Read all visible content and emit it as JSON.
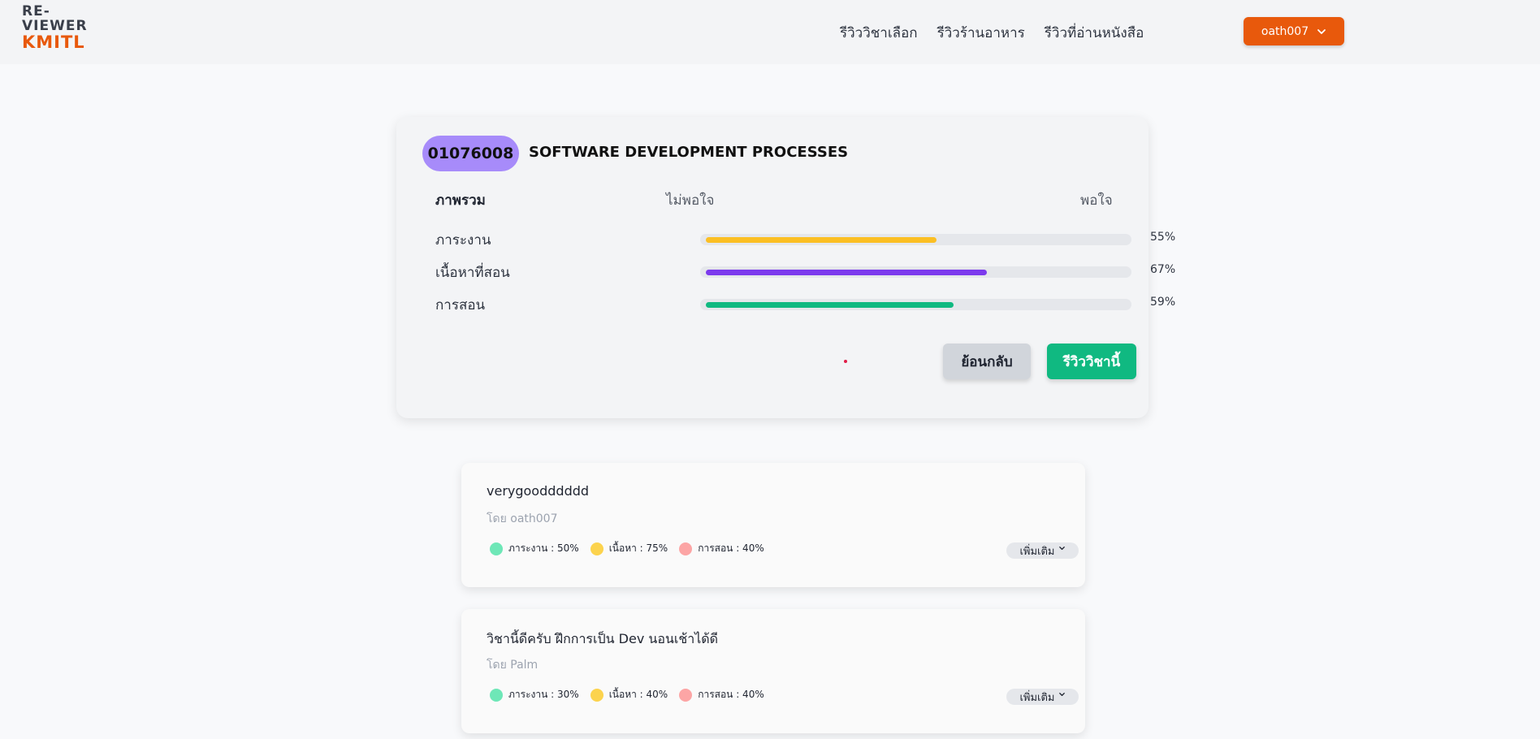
{
  "logo": {
    "line1": "RE-",
    "line2": "VIEWER",
    "line3": "KMITL"
  },
  "nav": {
    "items": [
      "รีวิววิชาเลือก",
      "รีวิวร้านอาหาร",
      "รีวิวที่อ่านหนังสือ"
    ]
  },
  "user": {
    "name": "oath007"
  },
  "course": {
    "code": "01076008",
    "name": "SOFTWARE DEVELOPMENT PROCESSES"
  },
  "summary": {
    "overall_label": "ภาพรวม",
    "bad_label": "ไม่พอใจ",
    "good_label": "พอใจ",
    "metrics": [
      {
        "name": "ภาระงาน",
        "percent": 55,
        "pct_text": "55%",
        "color": "#fbbf24"
      },
      {
        "name": "เนื้อหาที่สอน",
        "percent": 67,
        "pct_text": "67%",
        "color": "#7c3aed"
      },
      {
        "name": "การสอน",
        "percent": 59,
        "pct_text": "59%",
        "color": "#10b981"
      }
    ],
    "back_label": "ย้อนกลับ",
    "review_label": "รีวิววิชานี้"
  },
  "reviews": [
    {
      "text": "verygoodddddd",
      "author": "โดย oath007",
      "tags": [
        {
          "label": "ภาระงาน : 50%",
          "color": "#6ee7b7"
        },
        {
          "label": "เนื้อหา : 75%",
          "color": "#fcd34d"
        },
        {
          "label": "การสอน : 40%",
          "color": "#fca5a5"
        }
      ],
      "more_label": "เพิ่มเติม"
    },
    {
      "text": "วิชานี้ดีครับ ฝึกการเป็น Dev นอนเช้าได้ดี",
      "author": "โดย Palm",
      "tags": [
        {
          "label": "ภาระงาน : 30%",
          "color": "#6ee7b7"
        },
        {
          "label": "เนื้อหา : 40%",
          "color": "#fcd34d"
        },
        {
          "label": "การสอน : 40%",
          "color": "#fca5a5"
        }
      ],
      "more_label": "เพิ่มเติม"
    }
  ],
  "icons": {
    "dropdown": "chevron-down-icon",
    "more": "chevron-down-icon"
  }
}
